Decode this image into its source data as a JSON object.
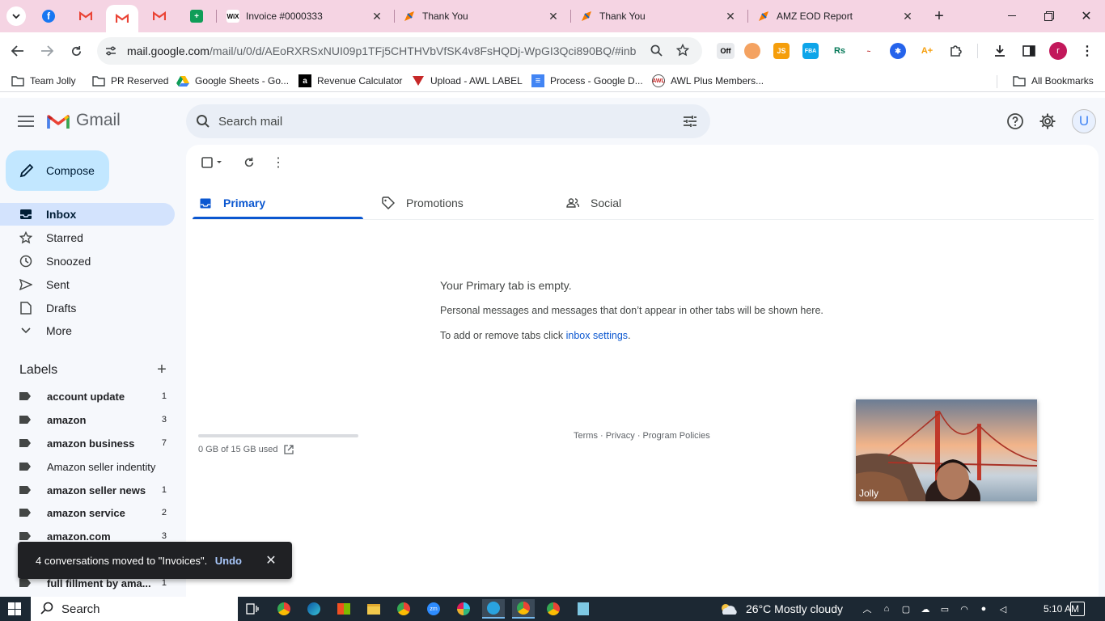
{
  "browser": {
    "tabs": [
      {
        "title": "Invoice #0000333",
        "favicon": "wix-icon"
      },
      {
        "title": "Thank You",
        "favicon": "pen-icon"
      },
      {
        "title": "Thank You",
        "favicon": "pen-icon"
      },
      {
        "title": "AMZ EOD Report",
        "favicon": "pen-icon"
      }
    ],
    "url_host": "mail.google.com",
    "url_path": "/mail/u/0/d/AEoRXRSxNUI09p1TFj5CHTHVbVfSK4v8FsHQDj-WpGI3Qci890BQ/#inbox",
    "profile_initial": "r",
    "bookmarks": [
      {
        "label": "Team Jolly",
        "icon": "folder-icon"
      },
      {
        "label": "PR Reserved",
        "icon": "folder-icon"
      },
      {
        "label": "Google Sheets - Go...",
        "icon": "drive-icon"
      },
      {
        "label": "Revenue Calculator",
        "icon": "amazon-icon"
      },
      {
        "label": "Upload - AWL LABEL",
        "icon": "awl-icon"
      },
      {
        "label": "Process - Google D...",
        "icon": "docs-icon"
      },
      {
        "label": "AWL Plus Members...",
        "icon": "awl-plus-icon"
      }
    ],
    "all_bookmarks": "All Bookmarks",
    "ext_off_label": "Off"
  },
  "gmail": {
    "brand": "Gmail",
    "search_placeholder": "Search mail",
    "avatar_initial": "U",
    "compose": "Compose",
    "nav": [
      {
        "label": "Inbox",
        "icon": "inbox-icon"
      },
      {
        "label": "Starred",
        "icon": "star-icon"
      },
      {
        "label": "Snoozed",
        "icon": "clock-icon"
      },
      {
        "label": "Sent",
        "icon": "send-icon"
      },
      {
        "label": "Drafts",
        "icon": "draft-icon"
      },
      {
        "label": "More",
        "icon": "chevron-down-icon"
      }
    ],
    "labels_title": "Labels",
    "labels": [
      {
        "name": "account update",
        "count": "1",
        "bold": true
      },
      {
        "name": "amazon",
        "count": "3",
        "bold": true
      },
      {
        "name": "amazon business",
        "count": "7",
        "bold": true
      },
      {
        "name": "Amazon seller indentity",
        "count": "",
        "bold": false
      },
      {
        "name": "amazon seller news",
        "count": "1",
        "bold": true
      },
      {
        "name": "amazon service",
        "count": "2",
        "bold": true
      },
      {
        "name": "amazon.com",
        "count": "3",
        "bold": true
      },
      {
        "name": "full fillment by ama...",
        "count": "1",
        "bold": true
      }
    ],
    "tabs": [
      {
        "label": "Primary",
        "icon": "inbox-tab-icon"
      },
      {
        "label": "Promotions",
        "icon": "tag-icon"
      },
      {
        "label": "Social",
        "icon": "people-icon"
      }
    ],
    "empty": {
      "title": "Your Primary tab is empty.",
      "description": "Personal messages and messages that don’t appear in other tabs will be shown here.",
      "settings_prefix": "To add or remove tabs click ",
      "settings_link": "inbox settings",
      "settings_suffix": "."
    },
    "storage": "0 GB of 15 GB used",
    "storage_used_fraction": 0,
    "footer": "Terms · Privacy · Program Policies",
    "snackbar": {
      "message": "4 conversations moved to \"Invoices\".",
      "action": "Undo"
    }
  },
  "video": {
    "name": "Jolly"
  },
  "taskbar": {
    "search": "Search",
    "weather": "26°C  Mostly cloudy",
    "time": "5:10 AM"
  },
  "colors": {
    "tabstrip": "#f5d4e3",
    "compose": "#c2e7ff",
    "active_nav": "#d3e3fd",
    "accent": "#0b57d0",
    "taskbar": "#1c2833"
  }
}
